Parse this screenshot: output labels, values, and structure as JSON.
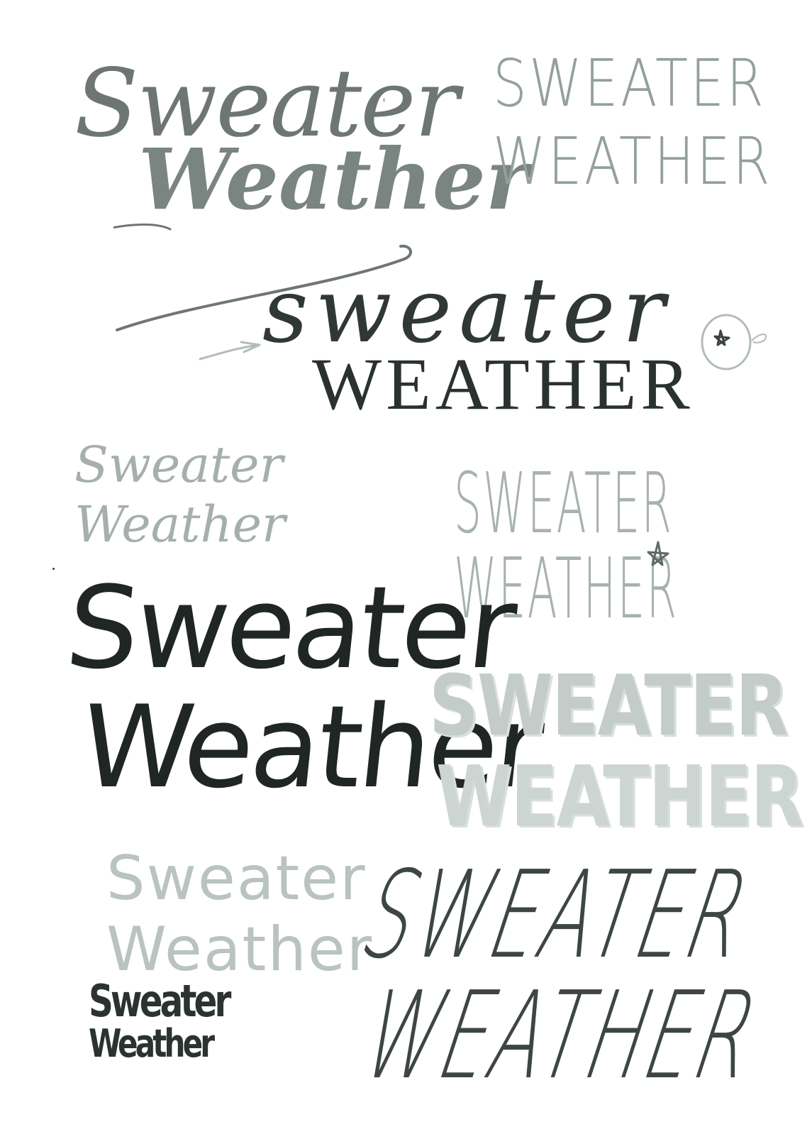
{
  "sketches": [
    {
      "line1": "Sweater",
      "line2": "Weather"
    },
    {
      "line1": "SWEATER",
      "line2": "WEATHER"
    },
    {
      "line1": "sweater",
      "line2": "WEATHER"
    },
    {
      "line1": "Sweater",
      "line2": "Weather"
    },
    {
      "line1": "SWEATER",
      "line2": "WEATHER"
    },
    {
      "line1": "Sweater",
      "line2": "Weather"
    },
    {
      "line1": "SWEATER",
      "line2": "WEATHER"
    },
    {
      "line1": "Sweater",
      "line2": "Weather"
    },
    {
      "line1": "Sweater",
      "line2": "Weather"
    },
    {
      "line1": "SWEATER",
      "line2": "WEATHER"
    }
  ],
  "colors": {
    "paper": "#ffffff",
    "ink_dark": "#2a3230",
    "ink_mid": "#6d7673",
    "ink_light": "#a7b2af",
    "ink_faint": "#c3ccc9"
  },
  "marks": [
    "star-icon",
    "star-icon",
    "arrow-icon"
  ]
}
